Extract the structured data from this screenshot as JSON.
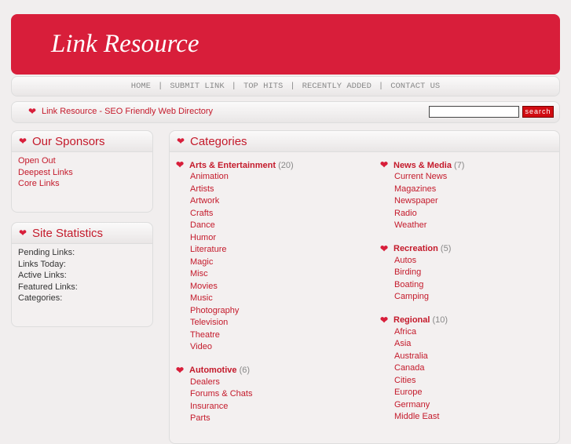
{
  "header": {
    "logo": "Link Resource"
  },
  "nav": [
    "HOME",
    "SUBMIT LINK",
    "TOP HITS",
    "RECENTLY ADDED",
    "CONTACT US"
  ],
  "nav_sep": "|",
  "tagline": "Link Resource - SEO Friendly Web Directory",
  "search": {
    "value": "",
    "button": "search"
  },
  "sponsors": {
    "title": "Our Sponsors",
    "items": [
      "Open Out",
      "Deepest Links",
      "Core Links"
    ]
  },
  "stats": {
    "title": "Site Statistics",
    "items": [
      "Pending Links:",
      "Links Today:",
      "Active Links:",
      "Featured Links:",
      "Categories:"
    ]
  },
  "categories": {
    "title": "Categories",
    "left": [
      {
        "name": "Arts & Entertainment",
        "count": "(20)",
        "subs": [
          "Animation",
          "Artists",
          "Artwork",
          "Crafts",
          "Dance",
          "Humor",
          "Literature",
          "Magic",
          "Misc",
          "Movies",
          "Music",
          "Photography",
          "Television",
          "Theatre",
          "Video"
        ]
      },
      {
        "name": "Automotive",
        "count": "(6)",
        "subs": [
          "Dealers",
          "Forums & Chats",
          "Insurance",
          "Parts"
        ]
      }
    ],
    "right": [
      {
        "name": "News & Media",
        "count": "(7)",
        "subs": [
          "Current News",
          "Magazines",
          "Newspaper",
          "Radio",
          "Weather"
        ]
      },
      {
        "name": "Recreation",
        "count": "(5)",
        "subs": [
          "Autos",
          "Birding",
          "Boating",
          "Camping"
        ]
      },
      {
        "name": "Regional",
        "count": "(10)",
        "subs": [
          "Africa",
          "Asia",
          "Australia",
          "Canada",
          "Cities",
          "Europe",
          "Germany",
          "Middle East"
        ]
      }
    ]
  },
  "colors": {
    "brand": "#d81e3a",
    "link": "#c41a2b"
  }
}
